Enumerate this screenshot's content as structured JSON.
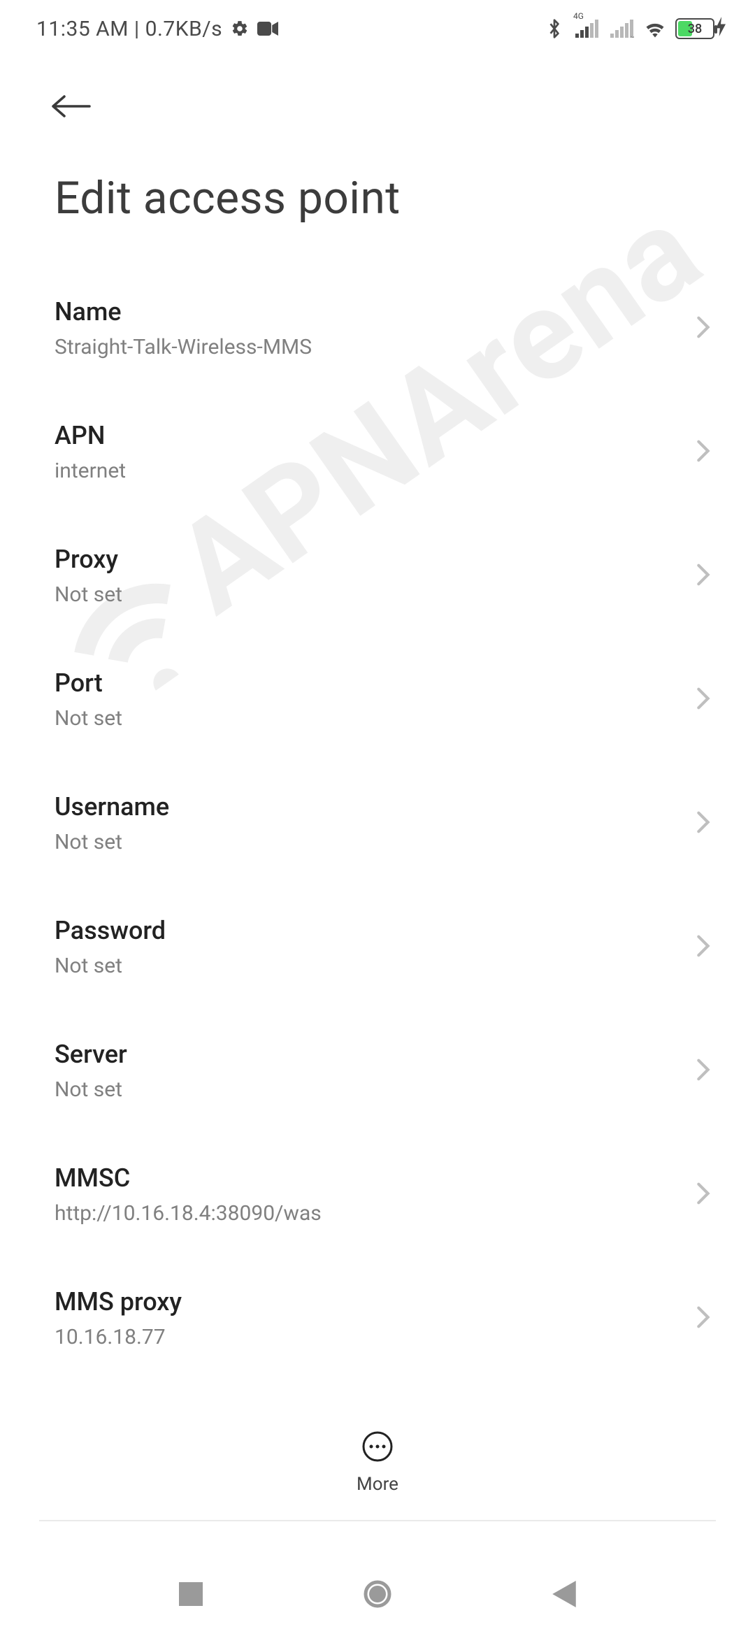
{
  "status": {
    "time": "11:35 AM",
    "speed": "0.7KB/s",
    "battery_pct": "38",
    "network_label": "4G"
  },
  "page": {
    "title": "Edit access point"
  },
  "rows": [
    {
      "label": "Name",
      "value": "Straight-Talk-Wireless-MMS"
    },
    {
      "label": "APN",
      "value": "internet"
    },
    {
      "label": "Proxy",
      "value": "Not set"
    },
    {
      "label": "Port",
      "value": "Not set"
    },
    {
      "label": "Username",
      "value": "Not set"
    },
    {
      "label": "Password",
      "value": "Not set"
    },
    {
      "label": "Server",
      "value": "Not set"
    },
    {
      "label": "MMSC",
      "value": "http://10.16.18.4:38090/was"
    },
    {
      "label": "MMS proxy",
      "value": "10.16.18.77"
    }
  ],
  "bottom": {
    "more_label": "More"
  },
  "watermark": {
    "text": "APNArena"
  }
}
